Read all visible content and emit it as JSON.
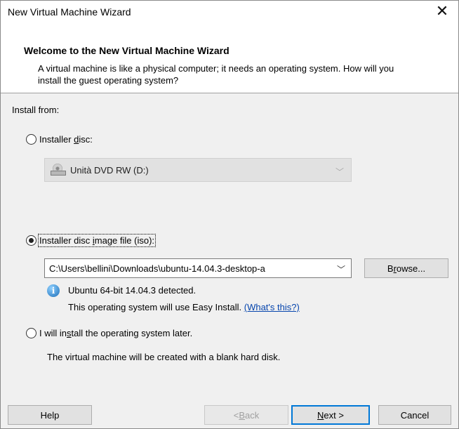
{
  "window": {
    "title": "New Virtual Machine Wizard",
    "close_glyph": "✕"
  },
  "header": {
    "title": "Welcome to the New Virtual Machine Wizard",
    "description": "A virtual machine is like a physical computer; it needs an operating system. How will you install the guest operating system?"
  },
  "content": {
    "install_from_label": "Install from:",
    "options": {
      "installer_disc": {
        "label_pre": "Installer ",
        "label_accel": "d",
        "label_post": "isc:",
        "selected": false,
        "drive_value": "Unità DVD RW (D:)",
        "drive_icon": "dvd-drive-icon"
      },
      "iso_file": {
        "label_pre": "Installer disc ",
        "label_accel": "i",
        "label_post": "mage file (iso):",
        "selected": true,
        "path_value": "C:\\Users\\bellini\\Downloads\\ubuntu-14.04.3-desktop-a",
        "browse_pre": "B",
        "browse_accel": "r",
        "browse_post": "owse...",
        "info_icon": "info-icon",
        "info_line1": "Ubuntu 64-bit 14.04.3 detected.",
        "info_line2": "This operating system will use Easy Install.",
        "info_link": "(What's this?)"
      },
      "install_later": {
        "label_pre": "I will in",
        "label_accel": "s",
        "label_post": "tall the operating system later.",
        "selected": false,
        "description": "The virtual machine will be created with a blank hard disk."
      }
    }
  },
  "footer": {
    "help": "Help",
    "back_pre": "< ",
    "back_accel": "B",
    "back_post": "ack",
    "next_accel": "N",
    "next_post": "ext >",
    "cancel": "Cancel"
  }
}
